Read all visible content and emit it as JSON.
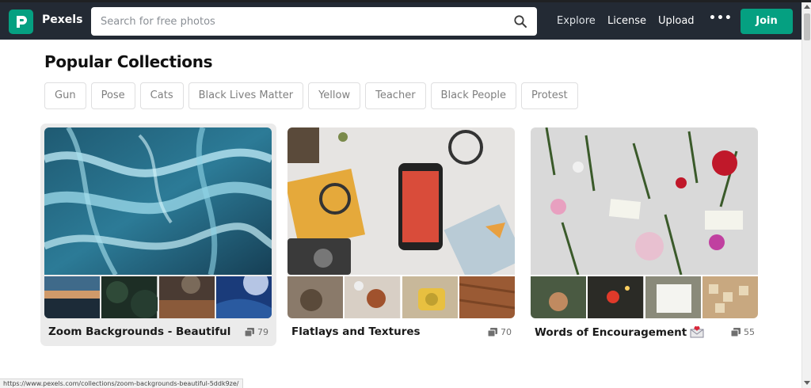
{
  "header": {
    "brand": "Pexels",
    "search_placeholder": "Search for free photos",
    "nav": [
      "Explore",
      "License",
      "Upload"
    ],
    "more_label": "•••",
    "join_label": "Join"
  },
  "page": {
    "title": "Popular Collections",
    "tags": [
      "Gun",
      "Pose",
      "Cats",
      "Black Lives Matter",
      "Yellow",
      "Teacher",
      "Black People",
      "Protest"
    ]
  },
  "collections": [
    {
      "title": "Zoom Backgrounds - Beautiful",
      "count": "79"
    },
    {
      "title": "Flatlays and Textures",
      "count": "70"
    },
    {
      "title": "Words of Encouragement",
      "count": "55"
    }
  ],
  "status_url": "https://www.pexels.com/collections/zoom-backgrounds-beautiful-5ddk9ze/",
  "colors": {
    "brand_green": "#05a081",
    "header_bg": "#232a34"
  },
  "icons": [
    "pexels-logo-icon",
    "search-icon",
    "more-icon",
    "collection-count-icon",
    "envelope-heart-icon"
  ]
}
